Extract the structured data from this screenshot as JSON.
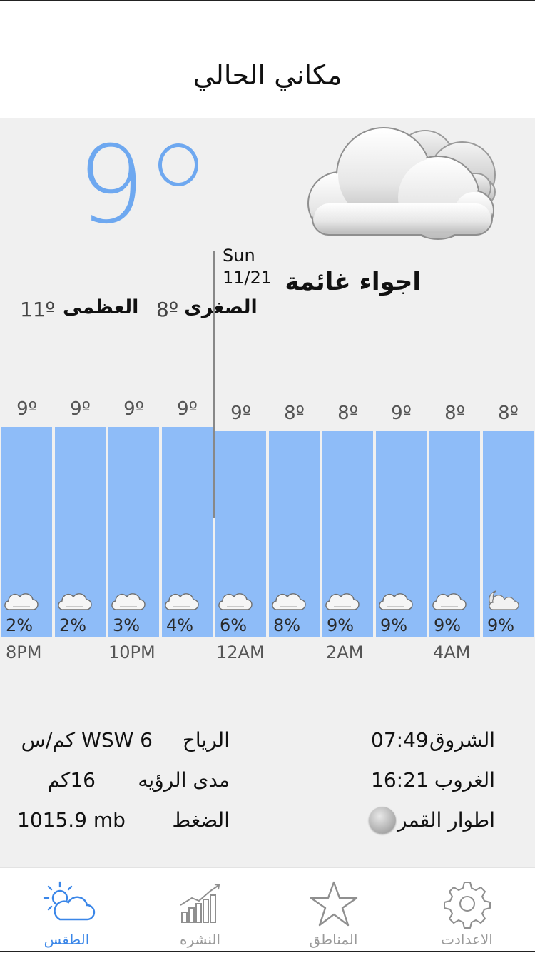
{
  "header": {
    "title": "مكاني الحالي"
  },
  "current": {
    "temp": "9",
    "icon": "cloudy-icon",
    "condition": "اجواء غائمة",
    "min_label": "الصغرى",
    "min_value": "8º",
    "max_label": "العظمى",
    "max_value": "11º"
  },
  "colors": {
    "accent": "#6ea8f0",
    "bar": "#8ebcf8",
    "active_tab": "#3a86e8"
  },
  "hourly": [
    {
      "temp": "9º",
      "precip": "2%",
      "precip_value": 2,
      "icon": "cloud-icon"
    },
    {
      "temp": "9º",
      "precip": "2%",
      "precip_value": 2,
      "icon": "cloud-icon"
    },
    {
      "temp": "9º",
      "precip": "3%",
      "precip_value": 3,
      "icon": "cloud-icon"
    },
    {
      "temp": "9º",
      "precip": "4%",
      "precip_value": 4,
      "icon": "cloud-icon"
    },
    {
      "temp": "9º",
      "precip": "6%",
      "precip_value": 6,
      "icon": "cloud-icon"
    },
    {
      "temp": "8º",
      "precip": "8%",
      "precip_value": 8,
      "icon": "cloud-icon"
    },
    {
      "temp": "8º",
      "precip": "9%",
      "precip_value": 9,
      "icon": "cloud-icon"
    },
    {
      "temp": "9º",
      "precip": "9%",
      "precip_value": 9,
      "icon": "cloud-icon"
    },
    {
      "temp": "8º",
      "precip": "9%",
      "precip_value": 9,
      "icon": "cloud-icon"
    },
    {
      "temp": "8º",
      "precip": "9%",
      "precip_value": 9,
      "icon": "cloud-moon-icon"
    }
  ],
  "day_marker": {
    "day": "Sun",
    "date": "11/21"
  },
  "time_labels": [
    "8PM",
    "10PM",
    "12AM",
    "2AM",
    "4AM"
  ],
  "details": {
    "wind_label": "الرياح",
    "wind_value": "WSW 6 كم/س",
    "visibility_label": "مدى الرؤيه",
    "visibility_value": "16كم",
    "pressure_label": "الضغط",
    "pressure_value": "1015.9 mb",
    "sunrise_label": "الشروق",
    "sunrise_value": "07:49",
    "sunset_label": "الغروب",
    "sunset_value": "16:21",
    "moon_label": "اطوار القمر"
  },
  "tabs": [
    {
      "label": "الطقس",
      "icon": "weather-icon",
      "active": true
    },
    {
      "label": "النشره",
      "icon": "chart-icon",
      "active": false
    },
    {
      "label": "المناطق",
      "icon": "star-icon",
      "active": false
    },
    {
      "label": "الاعدادت",
      "icon": "gear-icon",
      "active": false
    }
  ]
}
